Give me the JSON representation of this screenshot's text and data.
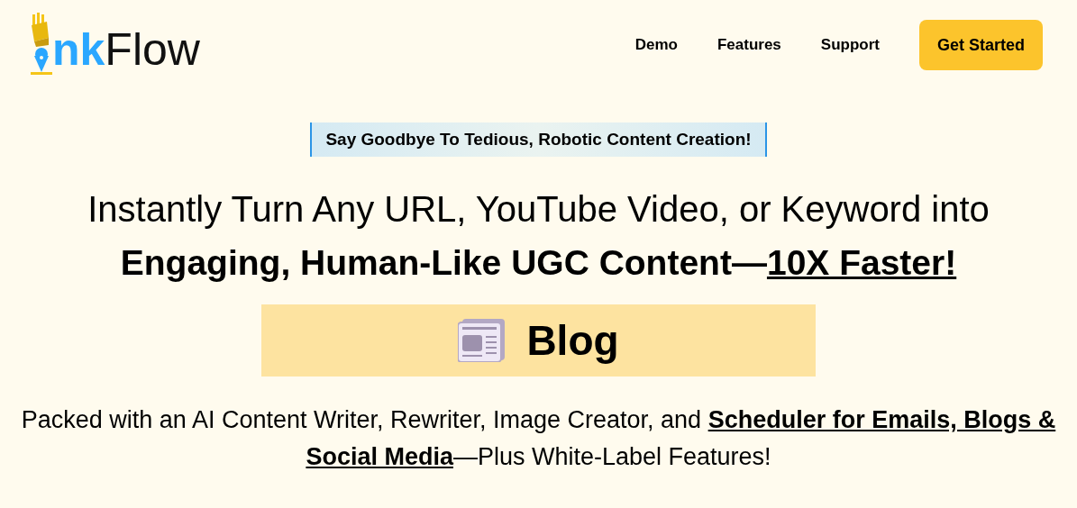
{
  "logo": {
    "accent": "nk",
    "text": "Flow"
  },
  "nav": {
    "links": [
      "Demo",
      "Features",
      "Support"
    ],
    "cta": "Get Started"
  },
  "badge": "Say Goodbye To Tedious, Robotic Content Creation!",
  "headline": {
    "line_1": "Instantly Turn Any URL, YouTube Video, or Keyword into",
    "line_2": {
      "text": "Engaging, Human-Like UGC Content—",
      "emphasis": "10X Faster!"
    }
  },
  "banner": {
    "label": "Blog"
  },
  "subtext": {
    "before": "Packed with an AI Content Writer, Rewriter, Image Creator, and ",
    "emphasis": "Scheduler for Emails, Blogs & Social Media",
    "after": "—Plus White-Label Features!"
  }
}
